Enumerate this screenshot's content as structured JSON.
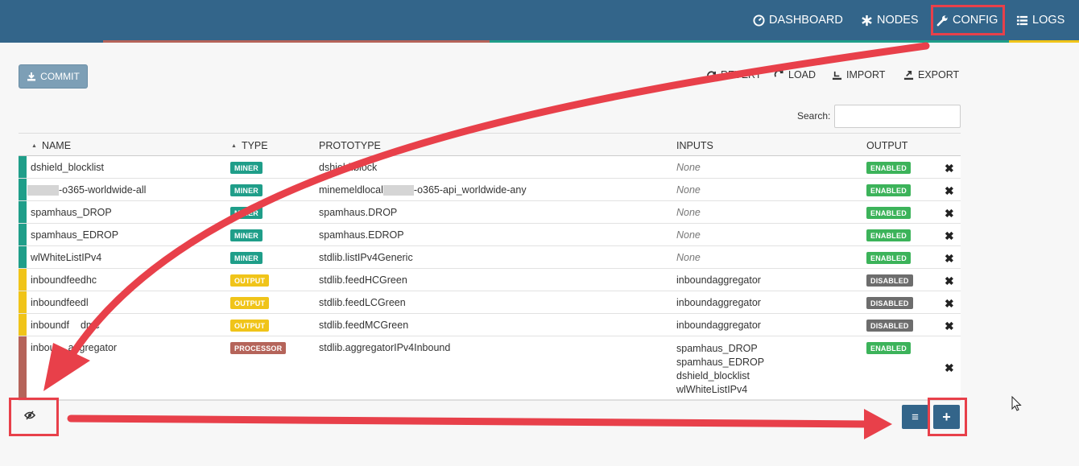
{
  "nav": {
    "dashboard": "DASHBOARD",
    "nodes": "NODES",
    "config": "CONFIG",
    "logs": "LOGS"
  },
  "toolbar": {
    "commit": "COMMIT",
    "revert": "REVERT",
    "load": "LOAD",
    "import": "IMPORT",
    "export": "EXPORT",
    "search_label": "Search:",
    "search_value": ""
  },
  "columns": {
    "name": "NAME",
    "type": "TYPE",
    "prototype": "PROTOTYPE",
    "inputs": "INPUTS",
    "output": "OUTPUT"
  },
  "rows": [
    {
      "name": "dshield_blocklist",
      "type": "MINER",
      "prototype": "dshield.block",
      "inputs": "None",
      "output": "ENABLED"
    },
    {
      "name": "-o365-worldwide-all",
      "type": "MINER",
      "prototype_pre": "minemeldlocal",
      "prototype": "-o365-api_worldwide-any",
      "inputs": "None",
      "output": "ENABLED"
    },
    {
      "name": "spamhaus_DROP",
      "type": "MINER",
      "prototype": "spamhaus.DROP",
      "inputs": "None",
      "output": "ENABLED"
    },
    {
      "name": "spamhaus_EDROP",
      "type": "MINER",
      "prototype": "spamhaus.EDROP",
      "inputs": "None",
      "output": "ENABLED"
    },
    {
      "name": "wlWhiteListIPv4",
      "type": "MINER",
      "prototype": "stdlib.listIPv4Generic",
      "inputs": "None",
      "output": "ENABLED"
    },
    {
      "name": "inboundfeedhc",
      "type": "OUTPUT",
      "prototype": "stdlib.feedHCGreen",
      "inputs": "inboundaggregator",
      "output": "DISABLED"
    },
    {
      "name": "inboundfeedl",
      "type": "OUTPUT",
      "prototype": "stdlib.feedLCGreen",
      "inputs": "inboundaggregator",
      "output": "DISABLED"
    },
    {
      "name": "inboundf",
      "name_suffix": "dmc",
      "type": "OUTPUT",
      "prototype": "stdlib.feedMCGreen",
      "inputs": "inboundaggregator",
      "output": "DISABLED"
    },
    {
      "name": "inbou",
      "name_suffix": "aggregator",
      "type": "PROCESSOR",
      "prototype": "stdlib.aggregatorIPv4Inbound",
      "inputs_list": [
        "spamhaus_DROP",
        "spamhaus_EDROP",
        "dshield_blocklist",
        "wlWhiteListIPv4"
      ],
      "output": "ENABLED"
    }
  ],
  "colors": {
    "navbar": "#33658a",
    "miner": "#1f9e89",
    "output": "#f0c419",
    "processor": "#b5645a",
    "enabled": "#3cb35a",
    "disabled": "#6d6d6d",
    "annotation": "#e8404a"
  },
  "icons": {
    "commit": "download-icon",
    "eye": "eye-slash-icon",
    "list": "list-icon",
    "add": "plus-icon",
    "delete": "times-icon"
  }
}
